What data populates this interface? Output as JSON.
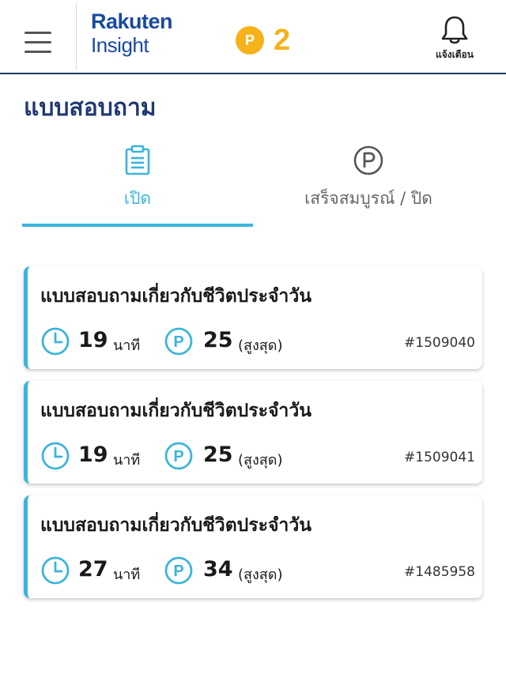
{
  "header": {
    "logo_top": "Rakuten",
    "logo_bottom": "Insight",
    "points_badge": "P",
    "points": "2",
    "notification_label": "แจ้งเตือน"
  },
  "page": {
    "title": "แบบสอบถาม"
  },
  "tabs": [
    {
      "label": "เปิด",
      "icon": "clipboard-icon",
      "active": true
    },
    {
      "label": "เสร็จสมบูรณ์ / ปิด",
      "icon": "p-circle-icon",
      "active": false
    }
  ],
  "colors": {
    "accent": "#3bb4dc",
    "title": "#1f3a72",
    "coin": "#f5b21b",
    "logo": "#1a4aa0"
  },
  "surveys": [
    {
      "title": "แบบสอบถามเกี่ยวกับชีวิตประจำวัน",
      "minutes": "19",
      "minutes_unit": "นาที",
      "points_badge": "P",
      "points": "25",
      "points_note": "(สูงสุด)",
      "id": "#1509040"
    },
    {
      "title": "แบบสอบถามเกี่ยวกับชีวิตประจำวัน",
      "minutes": "19",
      "minutes_unit": "นาที",
      "points_badge": "P",
      "points": "25",
      "points_note": "(สูงสุด)",
      "id": "#1509041"
    },
    {
      "title": "แบบสอบถามเกี่ยวกับชีวิตประจำวัน",
      "minutes": "27",
      "minutes_unit": "นาที",
      "points_badge": "P",
      "points": "34",
      "points_note": "(สูงสุด)",
      "id": "#1485958"
    }
  ]
}
